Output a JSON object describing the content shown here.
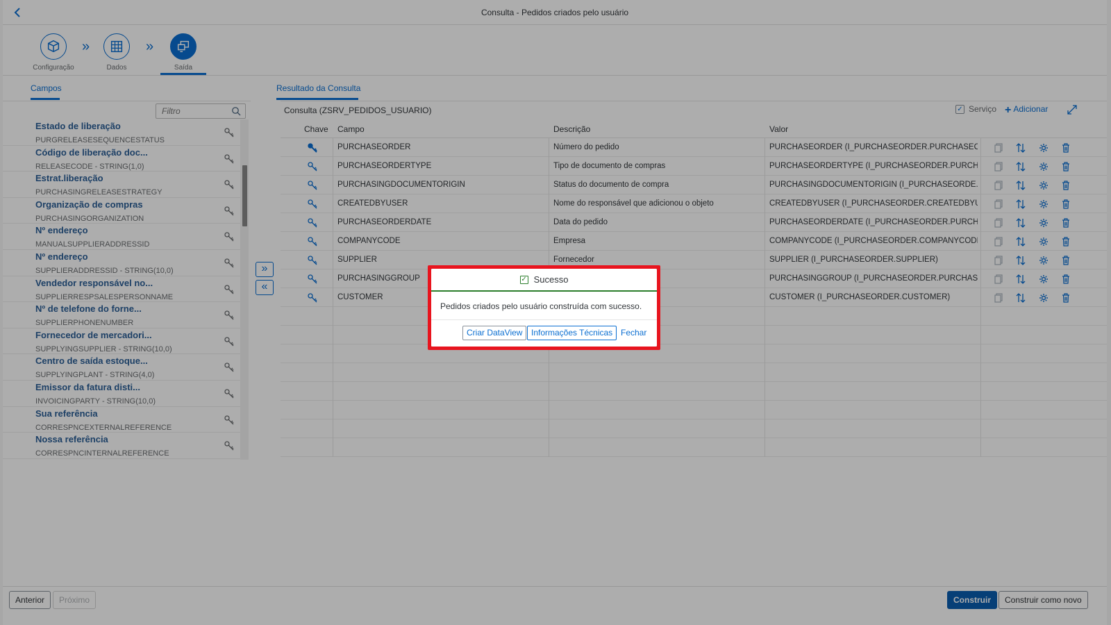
{
  "shell": {
    "title": "Consulta - Pedidos criados pelo usuário",
    "back_icon": "chevron-left-icon"
  },
  "wizard": {
    "steps": [
      {
        "label": "Configuração",
        "icon": "cube-icon"
      },
      {
        "label": "Dados",
        "icon": "grid-table-icon"
      },
      {
        "label": "Saída",
        "icon": "output-screens-icon"
      }
    ]
  },
  "left_tabs": {
    "campos": "Campos"
  },
  "right_tabs": {
    "resultado": "Resultado da Consulta"
  },
  "filter": {
    "placeholder": "Filtro"
  },
  "fields": [
    {
      "name": "Estado de liberação",
      "tech": "PURGRELEASESEQUENCESTATUS"
    },
    {
      "name": "Código de liberação doc...",
      "tech": "RELEASECODE - STRING(1,0)"
    },
    {
      "name": "Estrat.liberação",
      "tech": "PURCHASINGRELEASESTRATEGY"
    },
    {
      "name": "Organização de compras",
      "tech": "PURCHASINGORGANIZATION"
    },
    {
      "name": "Nº endereço",
      "tech": "MANUALSUPPLIERADDRESSID"
    },
    {
      "name": "Nº endereço",
      "tech": "SUPPLIERADDRESSID - STRING(10,0)"
    },
    {
      "name": "Vendedor responsável no...",
      "tech": "SUPPLIERRESPSALESPERSONNAME"
    },
    {
      "name": "Nº de telefone do forne...",
      "tech": "SUPPLIERPHONENUMBER"
    },
    {
      "name": "Fornecedor de mercadori...",
      "tech": "SUPPLYINGSUPPLIER - STRING(10,0)"
    },
    {
      "name": "Centro de saída estoque...",
      "tech": "SUPPLYINGPLANT - STRING(4,0)"
    },
    {
      "name": "Emissor da fatura disti...",
      "tech": "INVOICINGPARTY - STRING(10,0)"
    },
    {
      "name": "Sua referência",
      "tech": "CORRESPNCEXTERNALREFERENCE"
    },
    {
      "name": "Nossa referência",
      "tech": "CORRESPNCINTERNALREFERENCE"
    }
  ],
  "query": {
    "title": "Consulta (ZSRV_PEDIDOS_USUARIO)",
    "servico_label": "Serviço",
    "add_label": "Adicionar"
  },
  "table": {
    "headers": {
      "chave": "Chave",
      "campo": "Campo",
      "descricao": "Descrição",
      "valor": "Valor"
    },
    "rows": [
      {
        "key": true,
        "campo": "PURCHASEORDER",
        "descricao": "Número do pedido",
        "valor": "PURCHASEORDER (I_PURCHASEORDER.PURCHASEO..."
      },
      {
        "key": false,
        "campo": "PURCHASEORDERTYPE",
        "descricao": "Tipo de documento de compras",
        "valor": "PURCHASEORDERTYPE (I_PURCHASEORDER.PURCH..."
      },
      {
        "key": false,
        "campo": "PURCHASINGDOCUMENTORIGIN",
        "descricao": "Status do documento de compra",
        "valor": "PURCHASINGDOCUMENTORIGIN (I_PURCHASEORDE..."
      },
      {
        "key": false,
        "campo": "CREATEDBYUSER",
        "descricao": "Nome do responsável que adicionou o objeto",
        "valor": "CREATEDBYUSER (I_PURCHASEORDER.CREATEDBYU..."
      },
      {
        "key": false,
        "campo": "PURCHASEORDERDATE",
        "descricao": "Data do pedido",
        "valor": "PURCHASEORDERDATE (I_PURCHASEORDER.PURCH..."
      },
      {
        "key": false,
        "campo": "COMPANYCODE",
        "descricao": "Empresa",
        "valor": "COMPANYCODE (I_PURCHASEORDER.COMPANYCODE)"
      },
      {
        "key": false,
        "campo": "SUPPLIER",
        "descricao": "Fornecedor",
        "valor": "SUPPLIER (I_PURCHASEORDER.SUPPLIER)"
      },
      {
        "key": false,
        "campo": "PURCHASINGGROUP",
        "descricao": "",
        "valor": "PURCHASINGGROUP (I_PURCHASEORDER.PURCHASI..."
      },
      {
        "key": false,
        "campo": "CUSTOMER",
        "descricao": "",
        "valor": "CUSTOMER (I_PURCHASEORDER.CUSTOMER)"
      }
    ],
    "empty_rows": 8
  },
  "footer": {
    "anterior": "Anterior",
    "proximo": "Próximo",
    "construir": "Construir",
    "construir_novo": "Construir como novo"
  },
  "dialog": {
    "title": "Sucesso",
    "message": "Pedidos criados pelo usuário construída com sucesso.",
    "btn_dataview": "Criar DataView",
    "btn_info": "Informações Técnicas",
    "btn_fechar": "Fechar"
  },
  "colors": {
    "accent": "#0a6ed1",
    "highlight": "#e8141e",
    "success": "#2b7d2b"
  }
}
